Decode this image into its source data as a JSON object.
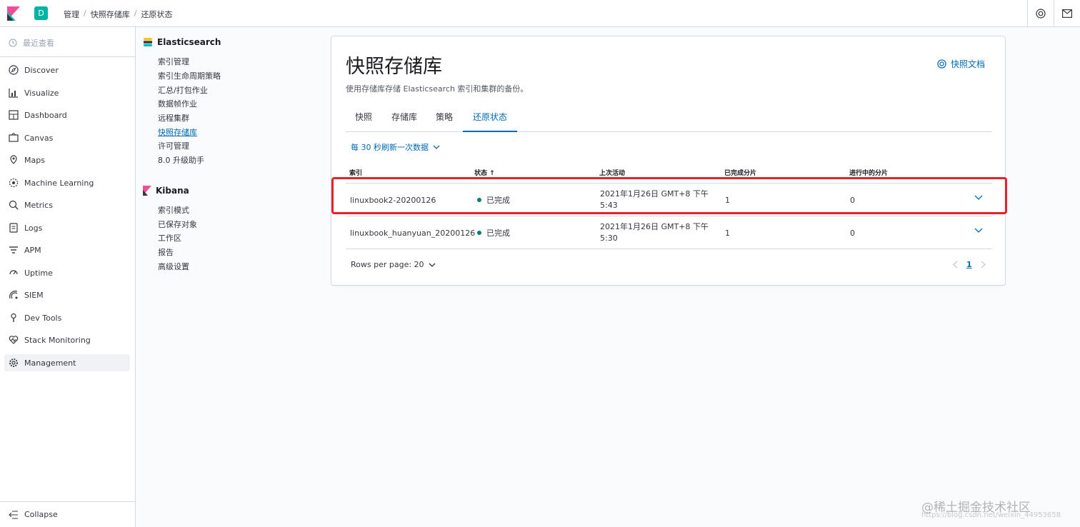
{
  "header": {
    "space_initial": "D",
    "breadcrumbs": [
      "管理",
      "快照存储库",
      "还原状态"
    ]
  },
  "nav": {
    "recent_label": "最近查看",
    "items": [
      {
        "label": "Discover",
        "icon": "compass-icon"
      },
      {
        "label": "Visualize",
        "icon": "chart-icon"
      },
      {
        "label": "Dashboard",
        "icon": "dashboard-icon"
      },
      {
        "label": "Canvas",
        "icon": "canvas-icon"
      },
      {
        "label": "Maps",
        "icon": "map-pin-icon"
      },
      {
        "label": "Machine Learning",
        "icon": "ml-icon"
      },
      {
        "label": "Metrics",
        "icon": "metrics-icon"
      },
      {
        "label": "Logs",
        "icon": "logs-icon"
      },
      {
        "label": "APM",
        "icon": "apm-icon"
      },
      {
        "label": "Uptime",
        "icon": "uptime-icon"
      },
      {
        "label": "SIEM",
        "icon": "siem-icon"
      },
      {
        "label": "Dev Tools",
        "icon": "wrench-icon"
      },
      {
        "label": "Stack Monitoring",
        "icon": "heartbeat-icon"
      },
      {
        "label": "Management",
        "icon": "gear-icon"
      }
    ],
    "collapse_label": "Collapse"
  },
  "mgmt": {
    "elasticsearch": {
      "title": "Elasticsearch",
      "links": [
        "索引管理",
        "索引生命周期策略",
        "汇总/打包作业",
        "数据帧作业",
        "远程集群",
        "快照存储库",
        "许可管理",
        "8.0 升级助手"
      ]
    },
    "kibana": {
      "title": "Kibana",
      "links": [
        "索引模式",
        "已保存对象",
        "工作区",
        "报告",
        "高级设置"
      ]
    }
  },
  "panel": {
    "title": "快照存储库",
    "doc_link": "快照文档",
    "description": "使用存储库存储 Elasticsearch 索引和集群的备份。",
    "tabs": [
      "快照",
      "存储库",
      "策略",
      "还原状态"
    ],
    "refresh_label": "每 30 秒刷新一次数据",
    "columns": [
      "索引",
      "状态 ↑",
      "上次活动",
      "已完成分片",
      "进行中的分片"
    ],
    "rows": [
      {
        "index": "linuxbook2-20200126",
        "status": "已完成",
        "time1": "2021年1月26日 GMT+8 下午",
        "time2": "5:43",
        "done": "1",
        "in_progress": "0"
      },
      {
        "index": "linuxbook_huanyuan_20200126",
        "status": "已完成",
        "time1": "2021年1月26日 GMT+8 下午",
        "time2": "5:30",
        "done": "1",
        "in_progress": "0"
      }
    ],
    "rows_per_page": "Rows per page: 20",
    "page": "1"
  },
  "watermark": "@稀土掘金技术社区",
  "watermark_url": "https://blog.csdn.net/weixin_44953658",
  "colors": {
    "accent": "#006bb4",
    "success": "#017d73",
    "highlight": "#e8202a"
  }
}
